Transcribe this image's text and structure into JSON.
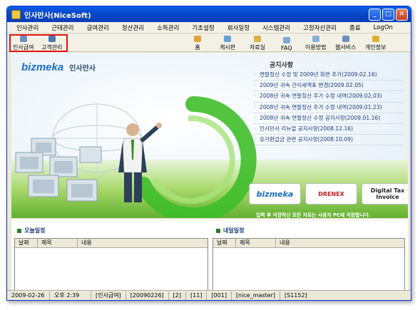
{
  "window": {
    "title": "인사만사(NiceSoft)"
  },
  "menu": [
    "인사관리",
    "근태관리",
    "급여관리",
    "정산관리",
    "소득관리",
    "기초설정",
    "회사일정",
    "시스템관리",
    "고정자산관리",
    "종료",
    "LogOn"
  ],
  "toolbar": {
    "left": [
      {
        "label": "인사급여",
        "icon": "payroll-icon",
        "color": "#6b8fc0"
      },
      {
        "label": "고객관리",
        "icon": "customer-icon",
        "color": "#4a79b0"
      }
    ],
    "right": [
      {
        "label": "홈",
        "icon": "home-icon",
        "color": "#e6a23a"
      },
      {
        "label": "게시판",
        "icon": "board-icon",
        "color": "#6aa0d8"
      },
      {
        "label": "자료실",
        "icon": "folder-icon",
        "color": "#d9b24a"
      },
      {
        "label": "FAQ",
        "icon": "faq-icon",
        "color": "#7fa8d8"
      },
      {
        "label": "이용방법",
        "icon": "guide-icon",
        "color": "#8ab0d8"
      },
      {
        "label": "웹서비스",
        "icon": "web-icon",
        "color": "#6e8fb8"
      },
      {
        "label": "개인정보",
        "icon": "key-icon",
        "color": "#e0b030"
      }
    ]
  },
  "brand": {
    "logo": "bizmeka",
    "subtitle": "인사만사"
  },
  "notices": {
    "title": "공지사항",
    "items": [
      "연말정산 수정 및 2009년 화면 추가(2009.02.16)",
      "2009년 귀속 간이세액표 변경(2009.02.05)",
      "2008년 귀속 연말정산 추가 수정 내역(2009.02.03)",
      "2008년 귀속 연말정산 추가 수정 내역(2009.01.23)",
      "2008년 귀속 연말정산 수정 공지사항(2009.01.16)",
      "인사만사 리뉴얼 공지사항(2008.12.16)",
      "유가환급금 관련 공지사항(2008.10.09)"
    ]
  },
  "partners": {
    "bizmeka": "bizmeka",
    "drenex": "DRENEX",
    "tax": "Digital Tax Invoice",
    "caption": "입력 후 저장하신 모든 자료는 사용자 PC에 저장합니다."
  },
  "today": {
    "title": "오늘일정",
    "columns": [
      "날짜",
      "제목",
      "내용"
    ]
  },
  "tomorrow": {
    "title": "내일일정",
    "columns": [
      "날짜",
      "제목",
      "내용"
    ]
  },
  "status": {
    "date": "2009-02-26",
    "time": "오후 2:39",
    "module": "[인사급여]",
    "ymd": "[20090226]",
    "a": "[2]",
    "b": "[11]",
    "c": "[001]",
    "user": "[nice_master]",
    "code": "[S1152]"
  }
}
